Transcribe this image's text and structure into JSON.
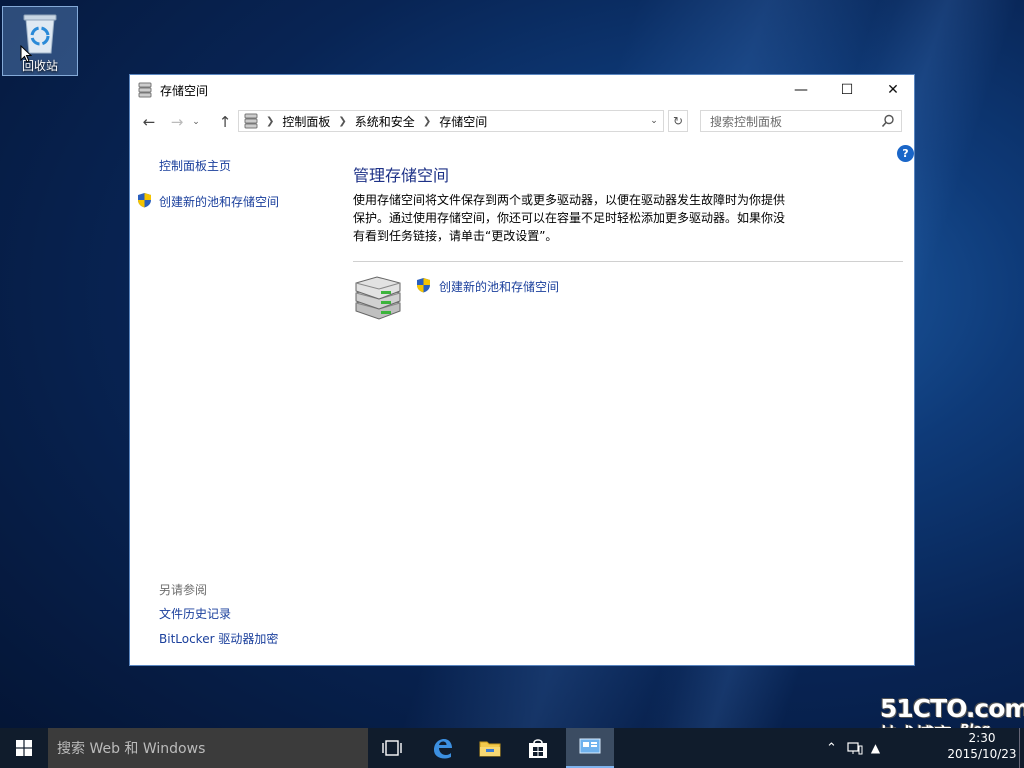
{
  "desktop": {
    "recycle_bin_label": "回收站"
  },
  "window": {
    "title": "存储空间",
    "controls": {
      "minimize": "—",
      "maximize": "☐",
      "close": "✕"
    }
  },
  "address_bar": {
    "crumbs": [
      "控制面板",
      "系统和安全",
      "存储空间"
    ],
    "search_placeholder": "搜索控制面板"
  },
  "sidebar": {
    "home_link": "控制面板主页",
    "create_link": "创建新的池和存储空间",
    "see_also_heading": "另请参阅",
    "see_also_links": [
      "文件历史记录",
      "BitLocker 驱动器加密"
    ]
  },
  "main": {
    "heading": "管理存储空间",
    "description": "使用存储空间将文件保存到两个或更多驱动器，以便在驱动器发生故障时为你提供保护。通过使用存储空间，你还可以在容量不足时轻松添加更多驱动器。如果你没有看到任务链接，请单击“更改设置”。",
    "create_link": "创建新的池和存储空间"
  },
  "taskbar": {
    "search_placeholder": "搜索 Web 和 Windows",
    "clock_time": "2:30",
    "clock_date": "2015/10/23"
  },
  "watermark": {
    "line1": "51CTO.com",
    "line2": "技术博客",
    "blog": "Blog"
  },
  "colors": {
    "link": "#1a3f9c",
    "heading": "#1e3287",
    "taskbar": "#101c2c",
    "help_blue": "#1a66c8"
  },
  "icons": [
    "recycle-bin-icon",
    "storage-spaces-icon",
    "back-arrow-icon",
    "forward-arrow-icon",
    "up-arrow-icon",
    "refresh-icon",
    "search-icon",
    "help-icon",
    "shield-icon",
    "drives-stack-icon",
    "windows-start-icon",
    "task-view-icon",
    "edge-icon",
    "file-explorer-icon",
    "store-icon",
    "control-panel-icon",
    "chevron-up-icon",
    "network-icon"
  ]
}
